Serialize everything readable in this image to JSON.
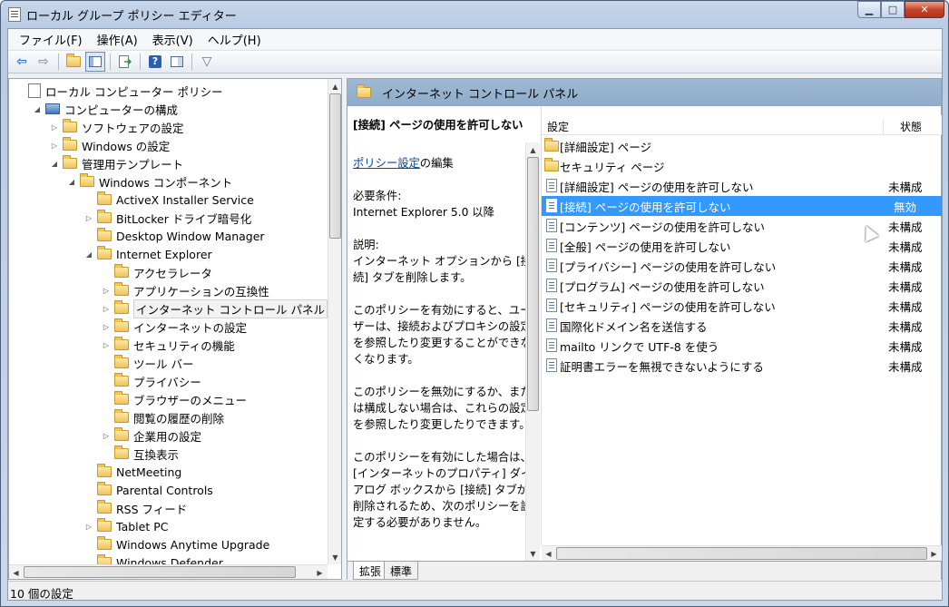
{
  "window": {
    "title": "ローカル グループ ポリシー エディター",
    "min_glyph": "▁",
    "max_glyph": "□",
    "close_glyph": "✕"
  },
  "menu": [
    "ファイル(F)",
    "操作(A)",
    "表示(V)",
    "ヘルプ(H)"
  ],
  "toolbar": {
    "icons": [
      "back-arrow-icon",
      "forward-arrow-icon",
      "up-folder-icon",
      "show-hide-tree-icon",
      "export-list-icon",
      "help-icon",
      "properties-view-icon",
      "filter-icon"
    ],
    "back": "⇦",
    "forward": "⇨",
    "help": "?",
    "filter": "▽"
  },
  "tree": [
    {
      "label": "ローカル コンピューター ポリシー",
      "level": 0,
      "icon": "doc",
      "twisty": ""
    },
    {
      "label": "コンピューターの構成",
      "level": 1,
      "icon": "pc",
      "twisty": "◢"
    },
    {
      "label": "ソフトウェアの設定",
      "level": 2,
      "icon": "folder",
      "twisty": "▷"
    },
    {
      "label": "Windows の設定",
      "level": 2,
      "icon": "folder",
      "twisty": "▷"
    },
    {
      "label": "管理用テンプレート",
      "level": 2,
      "icon": "folder",
      "twisty": "◢"
    },
    {
      "label": "Windows コンポーネント",
      "level": 3,
      "icon": "folder",
      "twisty": "◢"
    },
    {
      "label": "ActiveX Installer Service",
      "level": 4,
      "icon": "folder",
      "twisty": ""
    },
    {
      "label": "BitLocker ドライブ暗号化",
      "level": 4,
      "icon": "folder",
      "twisty": "▷"
    },
    {
      "label": "Desktop Window Manager",
      "level": 4,
      "icon": "folder",
      "twisty": ""
    },
    {
      "label": "Internet Explorer",
      "level": 4,
      "icon": "folder",
      "twisty": "◢"
    },
    {
      "label": "アクセラレータ",
      "level": 5,
      "icon": "folder",
      "twisty": ""
    },
    {
      "label": "アプリケーションの互換性",
      "level": 5,
      "icon": "folder",
      "twisty": "▷"
    },
    {
      "label": "インターネット コントロール パネル",
      "level": 5,
      "icon": "folder",
      "twisty": "▷",
      "selected": true
    },
    {
      "label": "インターネットの設定",
      "level": 5,
      "icon": "folder",
      "twisty": "▷"
    },
    {
      "label": "セキュリティの機能",
      "level": 5,
      "icon": "folder",
      "twisty": "▷"
    },
    {
      "label": "ツール バー",
      "level": 5,
      "icon": "folder",
      "twisty": ""
    },
    {
      "label": "プライバシー",
      "level": 5,
      "icon": "folder",
      "twisty": ""
    },
    {
      "label": "ブラウザーのメニュー",
      "level": 5,
      "icon": "folder",
      "twisty": ""
    },
    {
      "label": "閲覧の履歴の削除",
      "level": 5,
      "icon": "folder",
      "twisty": ""
    },
    {
      "label": "企業用の設定",
      "level": 5,
      "icon": "folder",
      "twisty": "▷"
    },
    {
      "label": "互換表示",
      "level": 5,
      "icon": "folder",
      "twisty": ""
    },
    {
      "label": "NetMeeting",
      "level": 4,
      "icon": "folder",
      "twisty": ""
    },
    {
      "label": "Parental Controls",
      "level": 4,
      "icon": "folder",
      "twisty": ""
    },
    {
      "label": "RSS フィード",
      "level": 4,
      "icon": "folder",
      "twisty": ""
    },
    {
      "label": "Tablet PC",
      "level": 4,
      "icon": "folder",
      "twisty": "▷"
    },
    {
      "label": "Windows Anytime Upgrade",
      "level": 4,
      "icon": "folder",
      "twisty": ""
    },
    {
      "label": "Windows Defender",
      "level": 4,
      "icon": "folder",
      "twisty": ""
    }
  ],
  "right_header": "インターネット コントロール パネル",
  "description": {
    "title": "[接続] ページの使用を許可しない",
    "link": "ポリシー設定",
    "link_suffix": "の編集",
    "req_label": "必要条件:",
    "req_value": "Internet Explorer 5.0 以降",
    "expl_label": "説明:",
    "expl_text": "インターネット オプションから [接続] タブを削除します。",
    "p1": "このポリシーを有効にすると、ユーザーは、接続およびプロキシの設定を参照したり変更することができなくなります。",
    "p2": "このポリシーを無効にするか、または構成しない場合は、これらの設定を参照したり変更したりできます。",
    "p3": "このポリシーを有効にした場合は、[インターネットのプロパティ] ダイアログ ボックスから [接続] タブが削除されるため、次のポリシーを設定する必要がありません。"
  },
  "columns": {
    "setting": "設定",
    "state": "状態"
  },
  "settings": [
    {
      "name": "[詳細設定] ページ",
      "state": "",
      "type": "folder"
    },
    {
      "name": "セキュリティ ページ",
      "state": "",
      "type": "folder"
    },
    {
      "name": "[詳細設定] ページの使用を許可しない",
      "state": "未構成",
      "type": "policy"
    },
    {
      "name": "[接続] ページの使用を許可しない",
      "state": "無効",
      "type": "policy",
      "selected": true
    },
    {
      "name": "[コンテンツ] ページの使用を許可しない",
      "state": "未構成",
      "type": "policy"
    },
    {
      "name": "[全般] ページの使用を許可しない",
      "state": "未構成",
      "type": "policy"
    },
    {
      "name": "[プライバシー] ページの使用を許可しない",
      "state": "未構成",
      "type": "policy"
    },
    {
      "name": "[プログラム] ページの使用を許可しない",
      "state": "未構成",
      "type": "policy"
    },
    {
      "name": "[セキュリティ] ページの使用を許可しない",
      "state": "未構成",
      "type": "policy"
    },
    {
      "name": "国際化ドメイン名を送信する",
      "state": "未構成",
      "type": "policy"
    },
    {
      "name": "mailto リンクで UTF-8 を使う",
      "state": "未構成",
      "type": "policy"
    },
    {
      "name": "証明書エラーを無視できないようにする",
      "state": "未構成",
      "type": "policy"
    }
  ],
  "tabs": [
    "拡張",
    "標準"
  ],
  "status": "10 個の設定",
  "scroll": {
    "up": "▲",
    "down": "▼",
    "left": "◀",
    "right": "▶"
  }
}
